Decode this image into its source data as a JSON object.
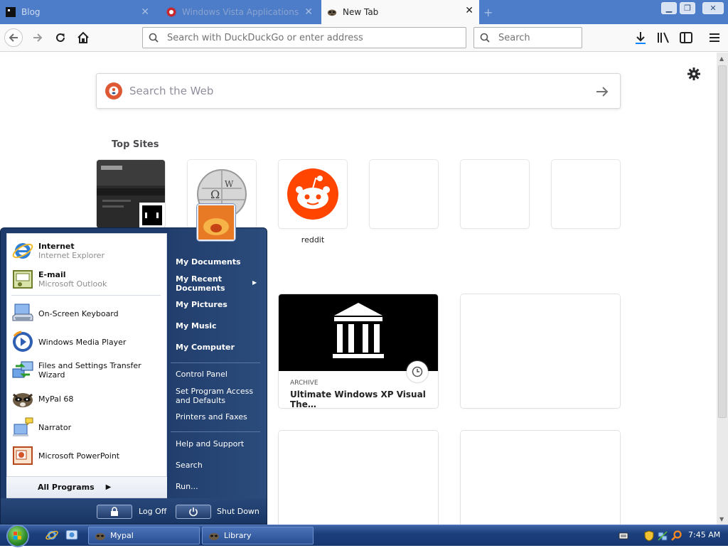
{
  "browser": {
    "tabs": [
      {
        "label": "Blog",
        "active": false
      },
      {
        "label": "Windows Vista Applications",
        "active": false
      },
      {
        "label": "New Tab",
        "active": true
      }
    ],
    "address_placeholder": "Search with DuckDuckGo or enter address",
    "search_placeholder": "Search"
  },
  "newtab": {
    "search_placeholder": "Search the Web",
    "top_sites_title": "Top Sites",
    "top_sites": [
      {
        "label": "",
        "thumbnail": "dark-game-screenshot"
      },
      {
        "label": "",
        "thumbnail": "wikipedia-globe"
      },
      {
        "label": "reddit",
        "thumbnail": "reddit-logo"
      },
      {
        "label": "",
        "thumbnail": "empty"
      },
      {
        "label": "",
        "thumbnail": "empty"
      },
      {
        "label": "",
        "thumbnail": "empty"
      }
    ],
    "highlight": {
      "kind": "ARCHIVE",
      "title": "Ultimate Windows XP Visual The…",
      "image": "archive-org-building"
    }
  },
  "start_menu": {
    "pinned": [
      {
        "title": "Internet",
        "subtitle": "Internet Explorer",
        "icon": "internet-explorer"
      },
      {
        "title": "E-mail",
        "subtitle": "Microsoft Outlook",
        "icon": "outlook"
      }
    ],
    "recent": [
      {
        "label": "On-Screen Keyboard",
        "icon": "keyboard"
      },
      {
        "label": "Windows Media Player",
        "icon": "media-player"
      },
      {
        "label": "Files and Settings Transfer Wizard",
        "icon": "transfer-wizard"
      },
      {
        "label": "MyPal 68",
        "icon": "mypal"
      },
      {
        "label": "Narrator",
        "icon": "narrator"
      },
      {
        "label": "Microsoft PowerPoint",
        "icon": "powerpoint"
      }
    ],
    "all_programs": "All Programs",
    "places": [
      {
        "label": "My Documents"
      },
      {
        "label": "My Recent Documents"
      },
      {
        "label": "My Pictures"
      },
      {
        "label": "My Music"
      },
      {
        "label": "My Computer"
      },
      {
        "label": "Control Panel"
      },
      {
        "label": "Set Program Access and Defaults"
      },
      {
        "label": "Printers and Faxes"
      },
      {
        "label": "Help and Support"
      },
      {
        "label": "Search"
      },
      {
        "label": "Run..."
      }
    ],
    "log_off": "Log Off",
    "shut_down": "Shut Down"
  },
  "taskbar": {
    "windows": [
      {
        "label": "Mypal"
      },
      {
        "label": "Library"
      }
    ],
    "clock": "7:45 AM"
  }
}
